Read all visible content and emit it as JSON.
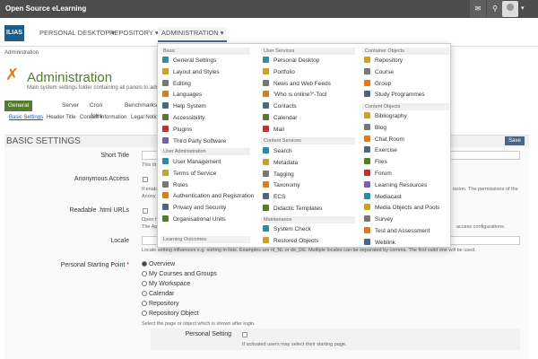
{
  "app": {
    "title": "Open Source eLearning",
    "logo": "ILIAS"
  },
  "topbar": {
    "mail_icon": "mail-icon",
    "search_icon": "search-icon",
    "user_icon": "user-avatar-icon",
    "caret": "▾"
  },
  "mainnav": {
    "items": [
      {
        "label": "PERSONAL DESKTOP ▾"
      },
      {
        "label": "REPOSITORY ▾"
      },
      {
        "label": "ADMINISTRATION ▾"
      }
    ]
  },
  "locator": "Administration",
  "page": {
    "title": "Administration",
    "description": "Main system settings folder containing all panels to admi"
  },
  "tabs": [
    {
      "label": "General Settings"
    },
    {
      "label": "Server"
    },
    {
      "label": "Cron Jobs"
    },
    {
      "label": "Benchmarks"
    }
  ],
  "subtabs": [
    {
      "label": "Basic Settings"
    },
    {
      "label": "Header Title"
    },
    {
      "label": "Contact Information"
    },
    {
      "label": "Legal Notice"
    }
  ],
  "section": {
    "title": "BASIC SETTINGS",
    "save": "Save"
  },
  "form": {
    "short_title": "Short Title",
    "short_title_help": "This tit",
    "anon": "Anonymous Access",
    "anon_help1": "If enab",
    "anon_help2": "Anony",
    "anon_help3": "ission. The permissions of the",
    "readable": "Readable .html URLs",
    "readable_help1": "Open h",
    "readable_help2": "The Ap",
    "readable_help3": "access configurations.",
    "locale": "Locale",
    "locale_help": "Locale setting influences e.g. sorting in lists. Examples are nl_NL or de_DE. Multiple locales can be separated by comma. The first valid one will be used.",
    "start_point": "Personal Starting Point",
    "required_mark": "*",
    "radios": [
      {
        "label": "Overview",
        "selected": true
      },
      {
        "label": "My Courses and Groups",
        "selected": false
      },
      {
        "label": "My Workspace",
        "selected": false
      },
      {
        "label": "Calendar",
        "selected": false
      },
      {
        "label": "Repository",
        "selected": false
      },
      {
        "label": "Repository Object",
        "selected": false
      }
    ],
    "start_help": "Select the page or object which is shown after login.",
    "personal_setting": "Personal Setting",
    "personal_help": "If activated users may select their starting page."
  },
  "dropdown": {
    "col1": {
      "basic_head": "Basic",
      "basic": [
        "General Settings",
        "Layout and Styles",
        "Editing",
        "Languages",
        "Help System",
        "Accessibility",
        "Plugins",
        "Third Party Software"
      ],
      "user_head": "User Administration",
      "user": [
        "User Management",
        "Terms of Service",
        "Roles",
        "Authentication and Registration",
        "Privacy and Security",
        "Organisational Units"
      ],
      "learning_head": "Learning Outcomes"
    },
    "col2": {
      "services_head": "User Services",
      "services": [
        "Personal Desktop",
        "Portfolio",
        "News and Web Feeds",
        "'Who is online?'-Tool",
        "Contacts",
        "Calendar",
        "Mail"
      ],
      "content_head": "Content Services",
      "content": [
        "Search",
        "Metadata",
        "Tagging",
        "Taxonomy",
        "ECS",
        "Didactic Templates"
      ],
      "maint_head": "Maintenance",
      "maint": [
        "System Check",
        "Restored Objects"
      ]
    },
    "col3": {
      "container_head": "Container Objects",
      "container": [
        "Repository",
        "Course",
        "Group",
        "Study Programmes"
      ],
      "content_head": "Content Objects",
      "content": [
        "Bibliography",
        "Blog",
        "Chat Room",
        "Exercise",
        "Files",
        "Forum",
        "Learning Resources",
        "Mediacast",
        "Media Objects and Pools",
        "Survey",
        "Test and Assessment",
        "Weblink"
      ]
    }
  }
}
